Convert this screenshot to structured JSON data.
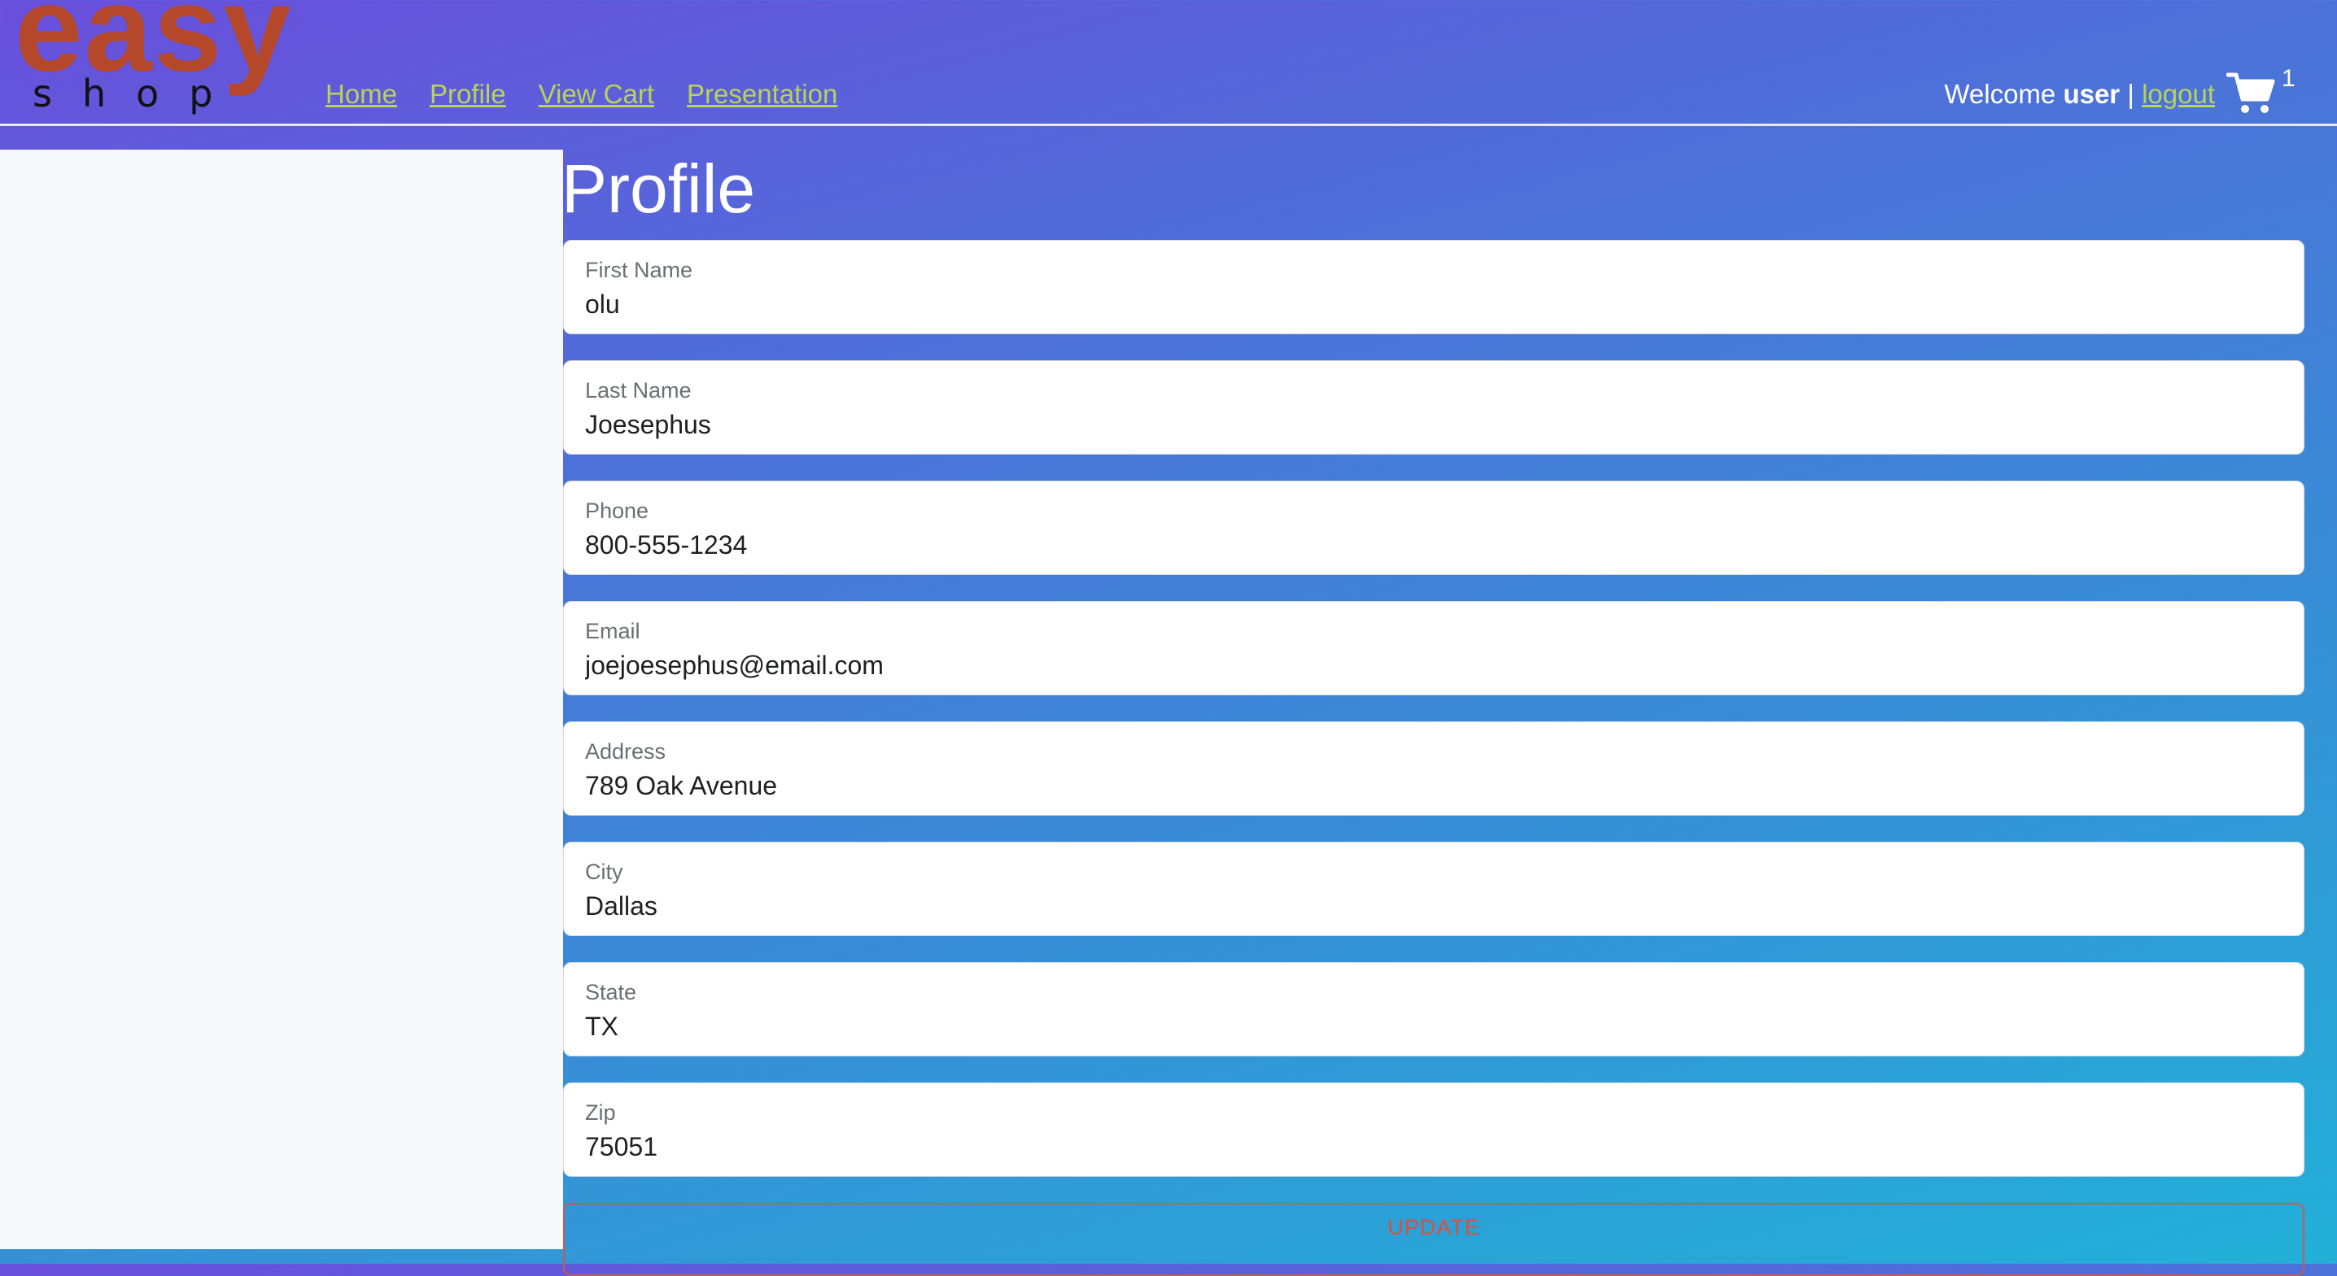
{
  "brand": {
    "logo_top": "easy",
    "logo_bottom": "shop"
  },
  "nav": {
    "items": [
      {
        "label": "Home"
      },
      {
        "label": "Profile"
      },
      {
        "label": "View Cart"
      },
      {
        "label": "Presentation"
      }
    ]
  },
  "user": {
    "welcome": "Welcome",
    "username": "user",
    "separator": "|",
    "logout_label": "logout"
  },
  "cart": {
    "icon": "shopping-cart-icon",
    "count": "1"
  },
  "page": {
    "title": "Profile"
  },
  "form": {
    "fields": [
      {
        "label": "First Name",
        "value": "olu"
      },
      {
        "label": "Last Name",
        "value": "Joesephus"
      },
      {
        "label": "Phone",
        "value": "800-555-1234"
      },
      {
        "label": "Email",
        "value": "joejoesephus@email.com"
      },
      {
        "label": "Address",
        "value": "789 Oak Avenue"
      },
      {
        "label": "City",
        "value": "Dallas"
      },
      {
        "label": "State",
        "value": "TX"
      },
      {
        "label": "Zip",
        "value": "75051"
      }
    ],
    "update_label": "UPDATE"
  },
  "colors": {
    "link": "#b7d35a",
    "logo_accent": "#b5482a",
    "update_text": "#e04c3e",
    "gradient_start": "#6a4fdc",
    "gradient_end": "#22b0d8"
  }
}
